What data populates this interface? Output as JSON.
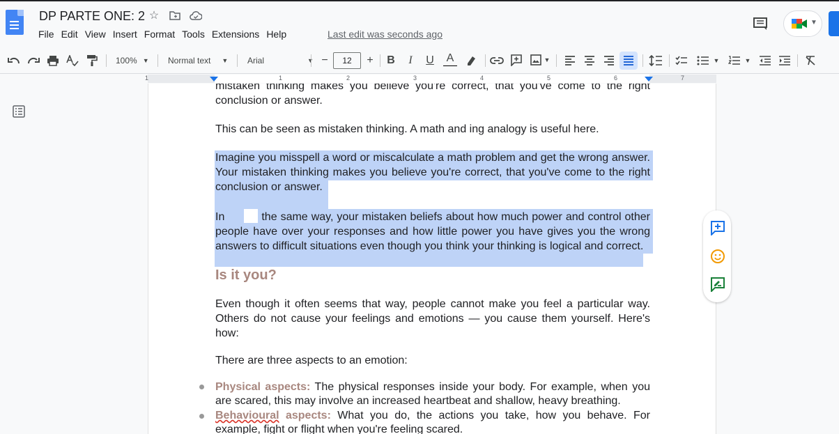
{
  "header": {
    "doc_title": "DP PARTE ONE: 2",
    "last_edit": "Last edit was seconds ago",
    "menu": [
      "File",
      "Edit",
      "View",
      "Insert",
      "Format",
      "Tools",
      "Extensions",
      "Help"
    ]
  },
  "toolbar": {
    "zoom": "100%",
    "style": "Normal text",
    "font": "Arial",
    "font_size": "12",
    "minus": "−",
    "plus": "+",
    "bold": "B",
    "italic": "I",
    "underline": "U",
    "text_color": "A"
  },
  "ruler": {
    "numbers": [
      "1",
      "1",
      "2",
      "3",
      "4",
      "5",
      "6",
      "7"
    ]
  },
  "document": {
    "para_top_partial": "mistaken thinking makes you believe you're correct, that you've come to the right conclusion or answer.",
    "para_analogy": "This can be seen as mistaken thinking. A math and ing analogy is useful here.",
    "para_imagine": "Imagine you misspell a word or miscalculate a math problem and get the wrong answer. Your mistaken thinking makes you believe you're correct, that you've come to the right conclusion or answer.",
    "para_in_prefix": "In",
    "para_in_rest": "the same way, your mistaken beliefs about how much power and control other people have over your responses and how little power you have gives you the wrong answers to difficult situations even though you think your thinking is logical and correct.",
    "heading": "Is it you?",
    "para_even": "Even though it often seems that way, people cannot make you feel a particular way. Others do not cause your feelings and emotions — you cause them yourself. Here's how:",
    "para_three": "There are three aspects to an emotion:",
    "bullet1_label": "Physical aspects:",
    "bullet1_text": " The physical responses inside your body. For example, when you are scared, this may involve an increased heartbeat and shallow, heavy breathing.",
    "bullet2_label_a": "Behavioural",
    "bullet2_label_b": " aspects:",
    "bullet2_text": " What you do, the actions you take, how you behave. For example, fight or flight when you're feeling scared."
  },
  "colors": {
    "selection": "#bed3f7",
    "heading": "#a8877f",
    "accent": "#1a73e8"
  }
}
